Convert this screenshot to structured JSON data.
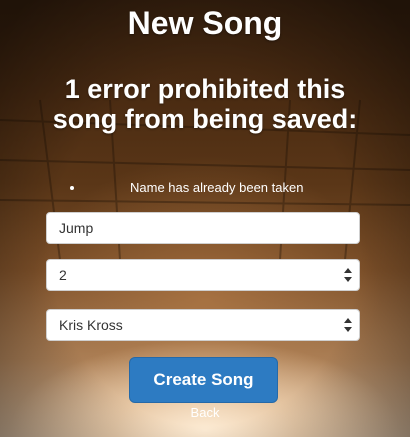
{
  "page": {
    "title": "New Song"
  },
  "errors": {
    "heading": "1 error prohibited this song from being saved:",
    "messages": [
      "Name has already been taken"
    ]
  },
  "form": {
    "title_value": "Jump",
    "rank_value": "2",
    "artist_value": "Kris Kross",
    "submit_label": "Create Song"
  },
  "nav": {
    "back_label": "Back"
  },
  "colors": {
    "button": "#2d7bc2",
    "text": "#ffffff"
  },
  "icons": {
    "select_arrows": "up-down-arrows-icon"
  }
}
